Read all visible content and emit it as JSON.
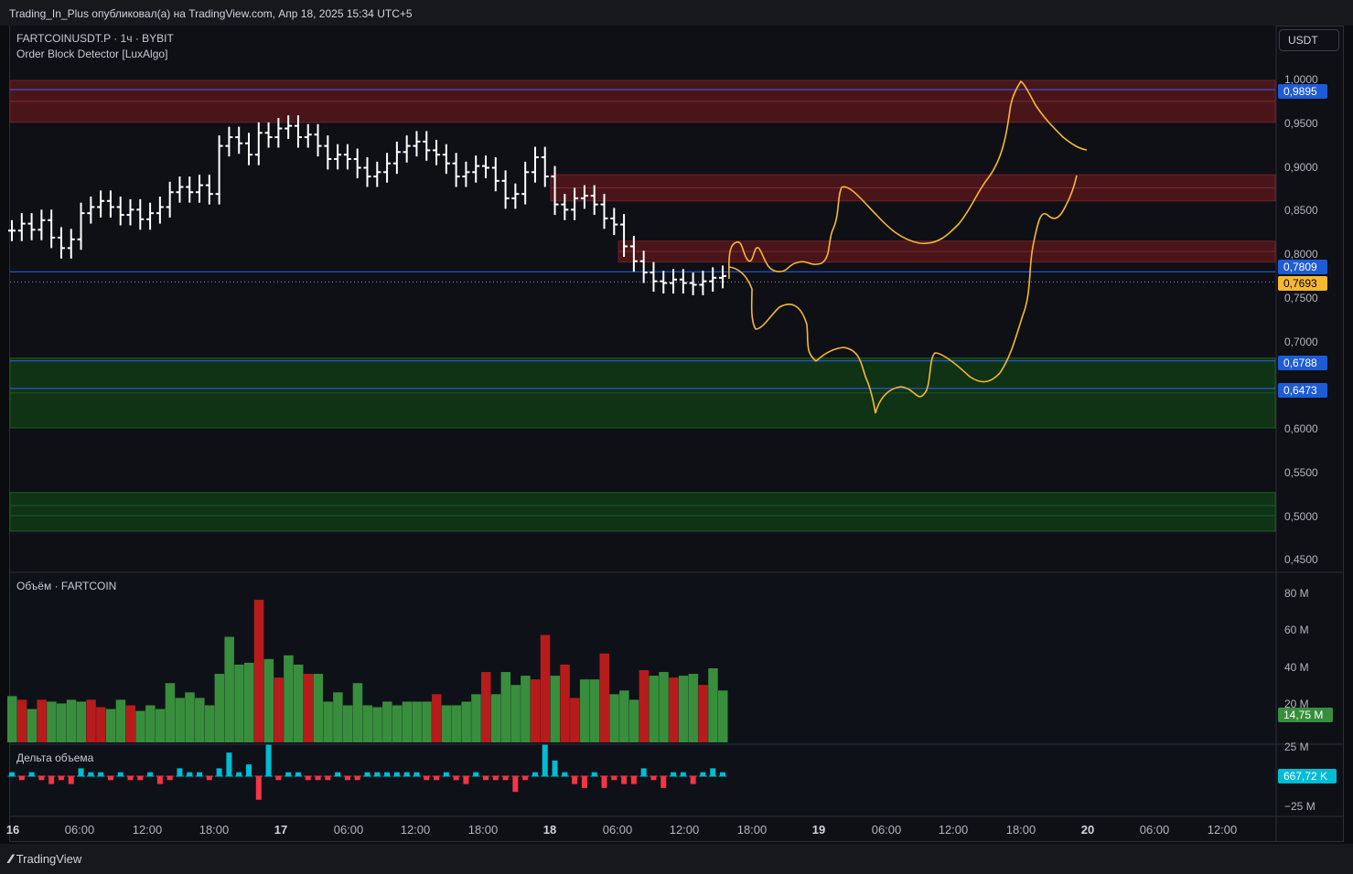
{
  "header": {
    "publisher": "Trading_In_Plus опубликовал(а) на TradingView.com, Апр 18, 2025 15:34 UTC+5"
  },
  "legend": {
    "symbol": "FARTCOINUSDT.P · 1ч · BYBIT",
    "indicator": "Order Block Detector [LuxAlgo]"
  },
  "currency": "USDT",
  "volume_pane": {
    "title": "Объём · FARTCOIN",
    "last_value": "14,75 M"
  },
  "delta_pane": {
    "title": "Дельта объема",
    "last_value": "667,72 K"
  },
  "price_tags": {
    "upper_ob": "0,9895",
    "blue_line": "0,7809",
    "last_price": "0,7693",
    "lower_ob_1": "0,6788",
    "lower_ob_2": "0,6473"
  },
  "price_axis_labels": [
    "1,0000",
    "0,9500",
    "0,9000",
    "0,8500",
    "0,8000",
    "0,7500",
    "0,7000",
    "0,6000",
    "0,5500",
    "0,5000",
    "0,4500"
  ],
  "volume_axis_labels": [
    "80 M",
    "60 M",
    "40 M",
    "20 M"
  ],
  "delta_axis_labels": [
    "25 M",
    "−25 M"
  ],
  "time_axis_labels": [
    "16",
    "06:00",
    "12:00",
    "18:00",
    "17",
    "06:00",
    "12:00",
    "18:00",
    "18",
    "06:00",
    "12:00",
    "18:00",
    "19",
    "06:00",
    "12:00",
    "18:00",
    "20",
    "06:00",
    "12:00"
  ],
  "footer": {
    "brand": "TradingView"
  },
  "colors": {
    "up": "#ffffff",
    "vol_up": "#388e3c",
    "vol_down": "#b71c1c",
    "delta_up": "#00bcd4",
    "delta_down": "#f23645",
    "drawing": "#f7b731",
    "bear_ob": "#4a1519",
    "bull_ob": "#0f3314",
    "price_tag_blue": "#1e5cd6",
    "price_tag_last": "#f7b731",
    "vol_tag": "#388e3c",
    "delta_tag": "#00bcd4"
  },
  "chart_data": {
    "type": "ohlc",
    "timeframe": "1h",
    "ylim": [
      0.45,
      1.0
    ],
    "order_blocks": {
      "bearish": [
        {
          "top": 1.0,
          "bottom": 0.952,
          "mid": 0.9895
        },
        {
          "top": 0.892,
          "bottom": 0.862
        },
        {
          "top": 0.816,
          "bottom": 0.792
        }
      ],
      "bullish": [
        {
          "top": 0.682,
          "bottom": 0.602,
          "mid": 0.6473
        },
        {
          "top": 0.528,
          "bottom": 0.485
        }
      ]
    },
    "last_price": 0.7693,
    "bars_close": [
      0.828,
      0.836,
      0.829,
      0.84,
      0.82,
      0.808,
      0.818,
      0.848,
      0.855,
      0.862,
      0.855,
      0.846,
      0.852,
      0.841,
      0.848,
      0.855,
      0.872,
      0.878,
      0.872,
      0.88,
      0.87,
      0.925,
      0.935,
      0.928,
      0.915,
      0.94,
      0.935,
      0.945,
      0.948,
      0.935,
      0.938,
      0.925,
      0.91,
      0.915,
      0.91,
      0.9,
      0.89,
      0.895,
      0.905,
      0.918,
      0.925,
      0.93,
      0.92,
      0.915,
      0.905,
      0.89,
      0.895,
      0.902,
      0.9,
      0.885,
      0.865,
      0.87,
      0.895,
      0.912,
      0.89,
      0.858,
      0.852,
      0.865,
      0.868,
      0.858,
      0.842,
      0.835,
      0.81,
      0.793,
      0.78,
      0.77,
      0.768,
      0.772,
      0.768,
      0.766,
      0.77,
      0.774,
      0.776
    ],
    "volume": [
      25,
      23,
      18,
      23,
      22,
      21,
      23,
      22,
      23,
      19,
      18,
      23,
      20,
      17,
      20,
      18,
      32,
      24,
      27,
      24,
      20,
      37,
      57,
      42,
      43,
      77,
      45,
      35,
      47,
      42,
      37,
      37,
      22,
      27,
      20,
      32,
      20,
      19,
      22,
      20,
      22,
      22,
      22,
      26,
      20,
      20,
      22,
      26,
      38,
      26,
      38,
      31,
      36,
      34,
      58,
      36,
      42,
      24,
      34,
      34,
      48,
      26,
      28,
      23,
      39,
      36,
      38,
      35,
      36,
      37,
      31,
      40,
      28
    ],
    "volume_up": [
      true,
      false,
      true,
      false,
      true,
      true,
      true,
      true,
      false,
      false,
      true,
      true,
      false,
      true,
      true,
      true,
      true,
      true,
      true,
      true,
      true,
      true,
      true,
      true,
      true,
      false,
      true,
      false,
      true,
      true,
      false,
      true,
      true,
      true,
      true,
      true,
      true,
      true,
      true,
      true,
      true,
      true,
      true,
      false,
      true,
      true,
      true,
      true,
      false,
      true,
      true,
      true,
      true,
      false,
      false,
      true,
      false,
      false,
      true,
      true,
      false,
      true,
      true,
      true,
      false,
      true,
      true,
      false,
      true,
      true,
      false,
      true,
      true
    ],
    "delta": [
      1,
      -1,
      1,
      -1,
      -2,
      -1,
      -2,
      2,
      1,
      1,
      -1,
      1,
      -1,
      -1,
      1,
      -2,
      -1,
      2,
      1,
      1,
      -1,
      2,
      6,
      1,
      3,
      -6,
      8,
      -1,
      1,
      1,
      -1,
      -1,
      -1,
      1,
      -1,
      -1,
      1,
      1,
      1,
      1,
      1,
      1,
      -1,
      -1,
      1,
      -1,
      -2,
      1,
      -1,
      -1,
      -1,
      -4,
      -1,
      1,
      8,
      4,
      1,
      -2,
      -3,
      1,
      -3,
      -1,
      -2,
      -2,
      2,
      -1,
      -3,
      1,
      1,
      -2,
      1,
      2,
      1
    ]
  }
}
